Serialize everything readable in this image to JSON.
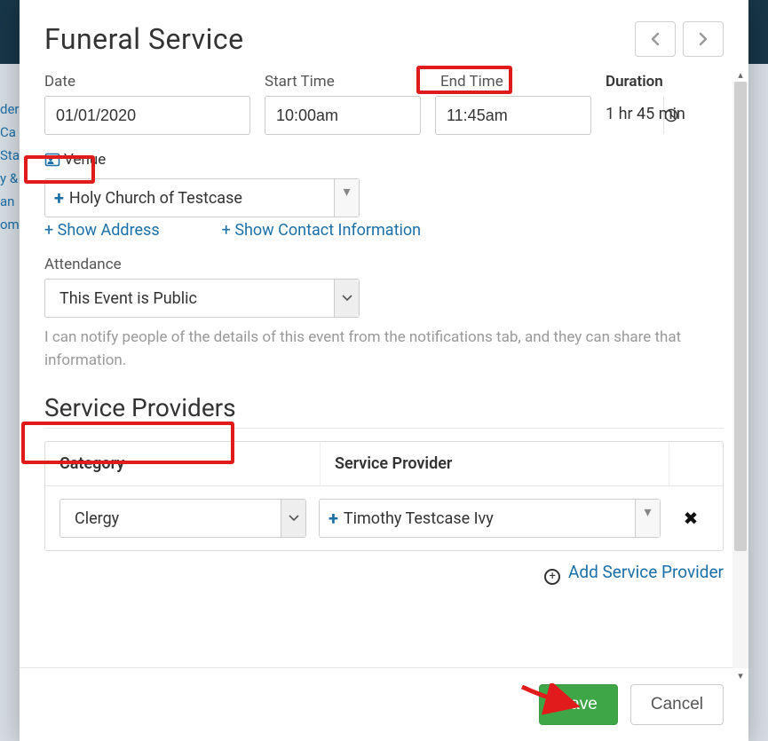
{
  "modal": {
    "title": "Funeral Service",
    "nav_prev_label": "Previous",
    "nav_next_label": "Next"
  },
  "fields": {
    "date": {
      "label": "Date",
      "value": "01/01/2020"
    },
    "start_time": {
      "label": "Start Time",
      "value": "10:00am"
    },
    "end_time": {
      "label": "End Time",
      "value": "11:45am"
    },
    "duration": {
      "label": "Duration",
      "value": "1 hr 45 min"
    },
    "venue": {
      "label": "Venue",
      "value": "Holy Church of Testcase"
    },
    "attendance": {
      "label": "Attendance",
      "value": "This Event is Public",
      "help": "I can notify people of the details of this event from the notifications tab, and they can share that information."
    }
  },
  "links": {
    "show_address": "+ Show Address",
    "show_contact": "+ Show Contact Information",
    "add_service_provider": "Add Service Provider"
  },
  "section": {
    "service_providers": "Service Providers"
  },
  "sp_table": {
    "col_category": "Category",
    "col_provider": "Service Provider",
    "rows": [
      {
        "category": "Clergy",
        "provider": "Timothy Testcase Ivy"
      }
    ]
  },
  "footer": {
    "save": "Save",
    "cancel": "Cancel"
  },
  "background": {
    "sidebar_fragments": [
      "der",
      "Ca",
      "Sta",
      "y &",
      "an",
      "om"
    ]
  }
}
